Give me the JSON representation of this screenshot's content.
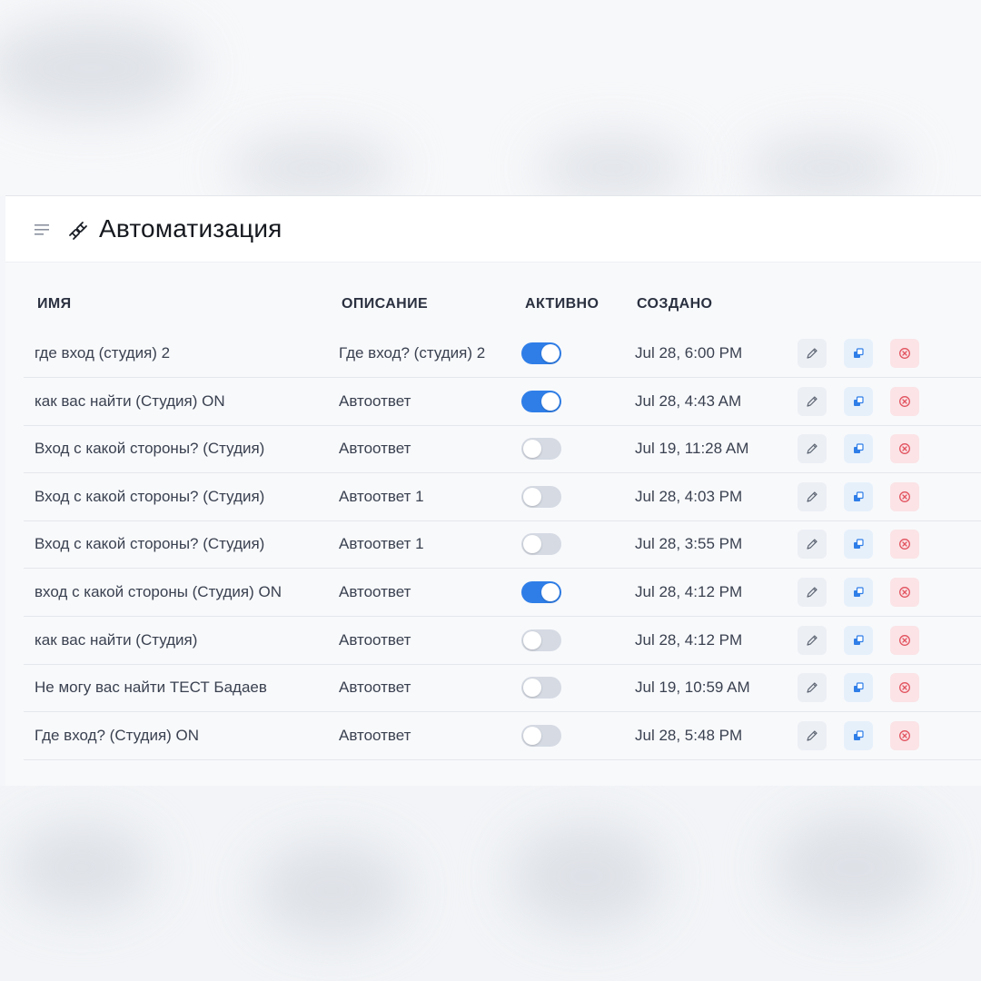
{
  "colors": {
    "accent": "#2f7ee8",
    "toggle_off": "#d5dae3",
    "delete": "#e2535f",
    "copy": "#2f7ee8"
  },
  "header": {
    "title": "Автоматизация",
    "menu_icon": "menu-icon",
    "title_icon": "plug-icon"
  },
  "table": {
    "columns": {
      "name": "ИМЯ",
      "description": "ОПИСАНИЕ",
      "active": "АКТИВНО",
      "created": "СОЗДАНО"
    },
    "rows": [
      {
        "name": "где вход (студия) 2",
        "description": "Где вход? (студия) 2",
        "active": true,
        "created": "Jul 28, 6:00 PM"
      },
      {
        "name": "как вас найти (Студия) ON",
        "description": "Автоответ",
        "active": true,
        "created": "Jul 28, 4:43 AM"
      },
      {
        "name": "Вход с какой стороны? (Студия)",
        "description": "Автоответ",
        "active": false,
        "created": "Jul 19, 11:28 AM"
      },
      {
        "name": "Вход с какой стороны? (Студия)",
        "description": "Автоответ 1",
        "active": false,
        "created": "Jul 28, 4:03 PM"
      },
      {
        "name": "Вход с какой стороны? (Студия)",
        "description": "Автоответ 1",
        "active": false,
        "created": "Jul 28, 3:55 PM"
      },
      {
        "name": "вход с какой стороны (Студия) ON",
        "description": "Автоответ",
        "active": true,
        "created": "Jul 28, 4:12 PM"
      },
      {
        "name": "как вас найти (Студия)",
        "description": "Автоответ",
        "active": false,
        "created": "Jul 28, 4:12 PM"
      },
      {
        "name": "Не могу вас найти ТЕСТ Бадаев",
        "description": "Автоответ",
        "active": false,
        "created": "Jul 19, 10:59 AM"
      },
      {
        "name": "Где вход? (Студия) ON",
        "description": "Автоответ",
        "active": false,
        "created": "Jul 28, 5:48 PM"
      }
    ],
    "row_actions": [
      "pencil-icon",
      "copy-icon",
      "delete-circle-x-icon"
    ]
  }
}
